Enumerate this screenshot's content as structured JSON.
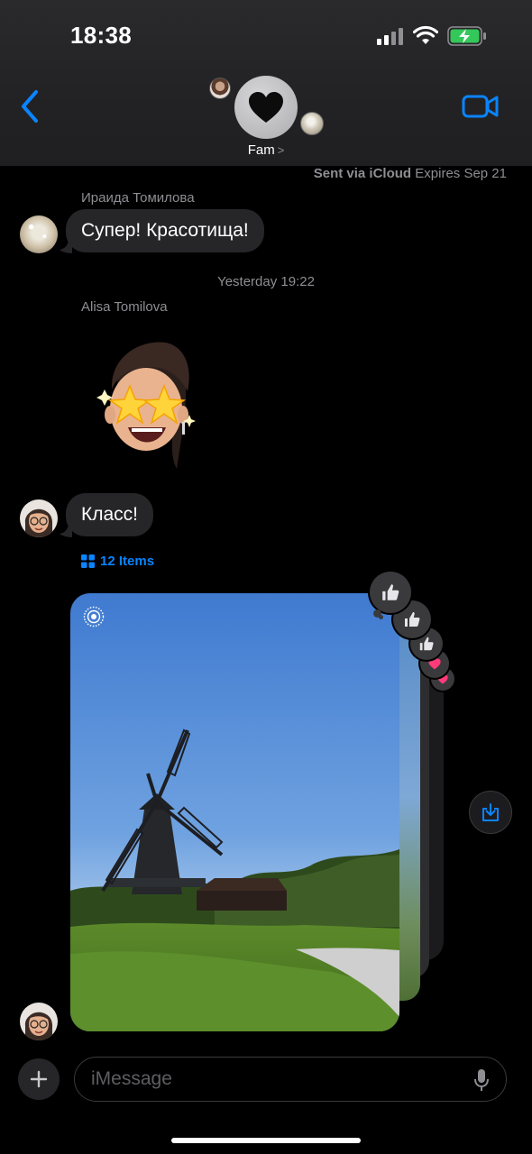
{
  "status_bar": {
    "time": "18:38"
  },
  "header": {
    "group_name": "Fam",
    "chevron": ">"
  },
  "delivery": {
    "sent_via": "Sent via iCloud",
    "expires": "Expires Sep 21"
  },
  "messages": [
    {
      "sender": "Ираида Томилова",
      "text": "Супер! Красотища!"
    },
    {
      "timestamp": "Yesterday 19:22"
    },
    {
      "sender": "Alisa Tomilova",
      "sticker": "memoji-star-eyes"
    },
    {
      "text": "Класс!"
    },
    {
      "collection_label": "12 Items",
      "attachment": "windmill-photo-stack"
    }
  ],
  "input": {
    "placeholder": "iMessage"
  },
  "colors": {
    "accent": "#0a84ff",
    "bubble": "#262628",
    "secondary_text": "#8e8e93",
    "tapback_heart": "#ff3b7a"
  },
  "icons": [
    "back-chevron-icon",
    "video-camera-icon",
    "heart-icon",
    "live-photo-icon",
    "thumbs-up-icon",
    "save-download-icon",
    "plus-icon",
    "microphone-icon",
    "grid-icon"
  ]
}
